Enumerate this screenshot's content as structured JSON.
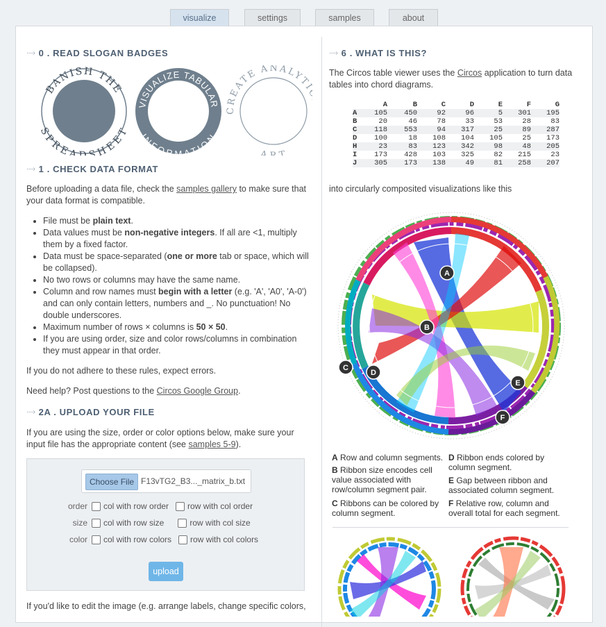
{
  "tabs": [
    "visualize",
    "settings",
    "samples",
    "about"
  ],
  "left": {
    "s0_title": "0 . READ SLOGAN BADGES",
    "badges": {
      "b1_top": "BANISH THE",
      "b1_bottom": "SPREADSHEET",
      "b2_top": "VISUALIZE TABULAR",
      "b2_bottom": "INFORMATION",
      "b3_top": "CREATE ANALYTICAL",
      "b3_bottom": "ART"
    },
    "s1_title": "1 . CHECK DATA FORMAT",
    "s1_intro_a": "Before uploading a data file, check the ",
    "s1_intro_link": "samples gallery",
    "s1_intro_b": " to make sure that your data format is compatible.",
    "rules": [
      {
        "a": "File must be ",
        "b": "plain text",
        "c": "."
      },
      {
        "a": "Data values must be ",
        "b": "non-negative integers",
        "c": ". If all are <1, multiply them by a fixed factor."
      },
      {
        "a": "Data must be space-separated (",
        "b": "one or more",
        "c": " tab or space, which will be collapsed)."
      },
      {
        "a": "No two rows or columns may have the same name.",
        "b": "",
        "c": ""
      },
      {
        "a": "Column and row names must ",
        "b": "begin with a letter",
        "c": " (e.g. 'A', 'A0', 'A-0') and can only contain letters, numbers and _. No punctuation! No double underscores."
      },
      {
        "a": "Maximum number of rows × columns is ",
        "b": "50 × 50",
        "c": "."
      },
      {
        "a": "If you are using order, size and color rows/columns in combination they must appear in that order.",
        "b": "",
        "c": ""
      }
    ],
    "warn": "If you do not adhere to these rules, expect errors.",
    "help_a": "Need help? Post questions to the ",
    "help_link": "Circos Google Group",
    "help_b": ".",
    "s2_title": "2A . UPLOAD YOUR FILE",
    "s2_intro_a": "If you are using the size, order or color options below, make sure your input file has the appropriate content (see ",
    "s2_intro_link": "samples 5-9",
    "s2_intro_b": ").",
    "choose_label": "Choose File",
    "file_name": "F13vTG2_B3..._matrix_b.txt",
    "options": [
      {
        "label": "order",
        "col": "col with row order",
        "row": "row with col order"
      },
      {
        "label": "size",
        "col": "col with row size",
        "row": "row with col size"
      },
      {
        "label": "color",
        "col": "col with row colors",
        "row": "row with col colors"
      }
    ],
    "upload_label": "upload",
    "edit_text": "If you'd like to edit the image (e.g. arrange labels, change specific colors,"
  },
  "right": {
    "s6_title": "6 . WHAT IS THIS?",
    "intro_a": "The Circos table viewer uses the ",
    "intro_link": "Circos",
    "intro_b": " application to turn data tables into chord diagrams.",
    "table": {
      "columns": [
        "A",
        "B",
        "C",
        "D",
        "E",
        "F",
        "G"
      ],
      "rows": [
        {
          "name": "A",
          "values": [
            "105",
            "450",
            "92",
            "96",
            "5",
            "301",
            "195"
          ]
        },
        {
          "name": "B",
          "values": [
            "20",
            "46",
            "78",
            "33",
            "53",
            "28",
            "83"
          ]
        },
        {
          "name": "C",
          "values": [
            "118",
            "553",
            "94",
            "317",
            "25",
            "89",
            "287"
          ]
        },
        {
          "name": "D",
          "values": [
            "100",
            "18",
            "108",
            "104",
            "105",
            "25",
            "173"
          ]
        },
        {
          "name": "H",
          "values": [
            "23",
            "83",
            "123",
            "342",
            "98",
            "48",
            "205"
          ]
        },
        {
          "name": "I",
          "values": [
            "173",
            "428",
            "103",
            "325",
            "82",
            "215",
            "23"
          ]
        },
        {
          "name": "J",
          "values": [
            "305",
            "173",
            "138",
            "49",
            "81",
            "258",
            "207"
          ]
        }
      ]
    },
    "into_text": "into circularly composited visualizations like this",
    "markers": [
      "A",
      "B",
      "C",
      "D",
      "E",
      "F"
    ],
    "legend": [
      {
        "k": "A",
        "t": "Row and column segments."
      },
      {
        "k": "B",
        "t": "Ribbon size encodes cell value associated with row/column segment pair."
      },
      {
        "k": "C",
        "t": "Ribbons can be colored by column segment."
      },
      {
        "k": "D",
        "t": "Ribbon ends colored by column segment."
      },
      {
        "k": "E",
        "t": "Gap between ribbon and associated column segment."
      },
      {
        "k": "F",
        "t": "Relative row, column and overall total for each segment."
      }
    ]
  },
  "colors": {
    "tab_active_bg": "#d6e3ef",
    "badge_fill": "#6f7f8d",
    "upload_button": "#6fb6e8",
    "choose_button": "#a7c8e8"
  }
}
